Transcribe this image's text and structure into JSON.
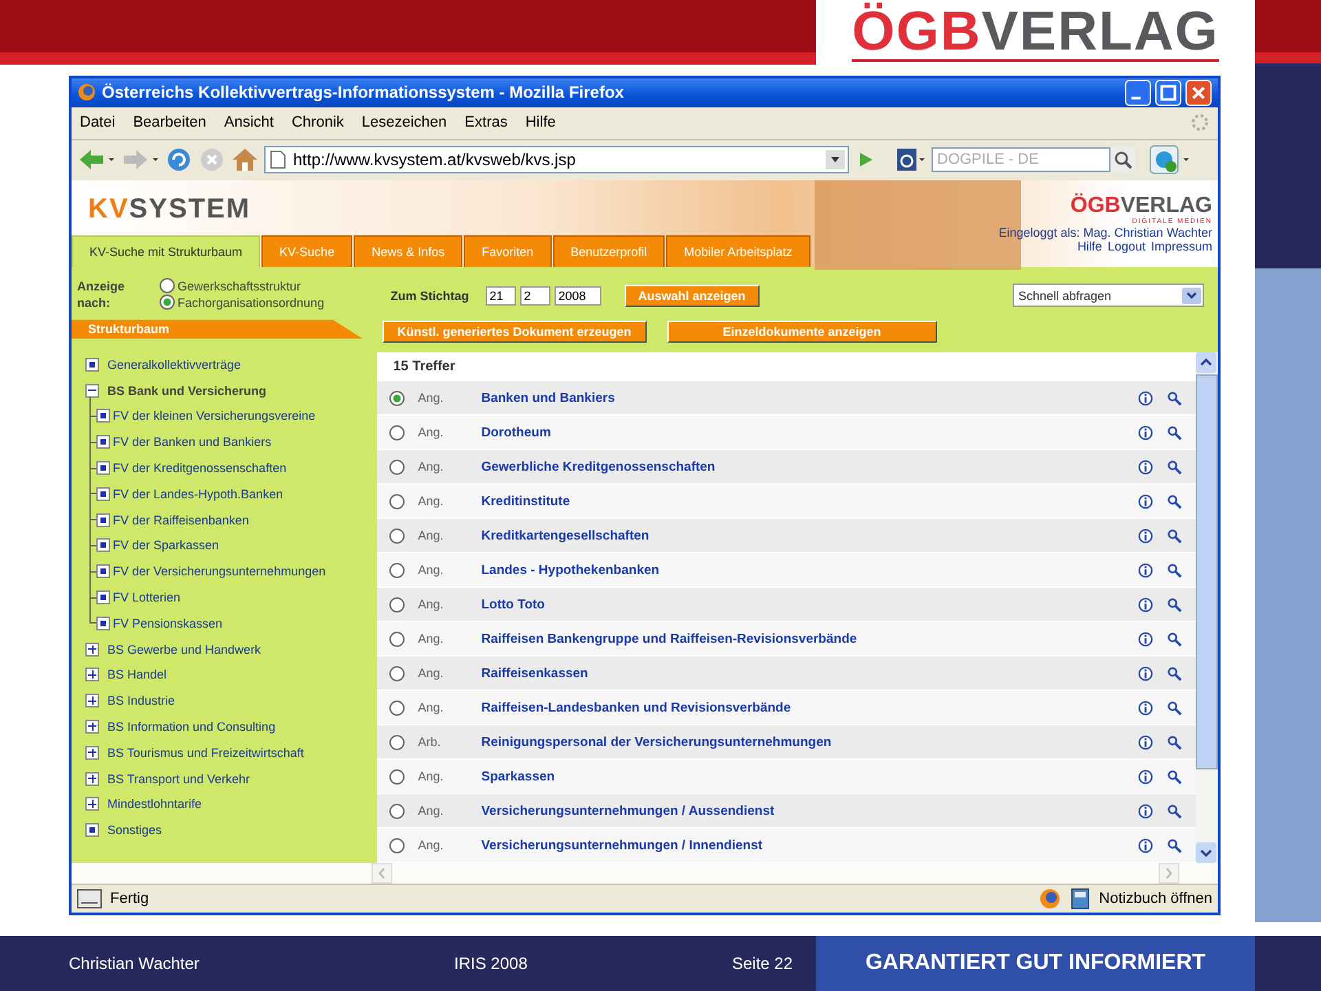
{
  "slide_header": {
    "logo": {
      "part_1": "ÖGB",
      "part_2": "VERLAG"
    }
  },
  "browser": {
    "title": "Österreichs Kollektivvertrags-Informationssystem - Mozilla Firefox",
    "menu": [
      "Datei",
      "Bearbeiten",
      "Ansicht",
      "Chronik",
      "Lesezeichen",
      "Extras",
      "Hilfe"
    ],
    "address": "http://www.kvsystem.at/kvsweb/kvs.jsp",
    "search": {
      "placeholder": "DOGPILE - DE"
    },
    "status": "Fertig",
    "status_right": "Notizbuch öffnen"
  },
  "site_header": {
    "logo": {
      "part_1": "KV",
      "part_2": "SYSTEM"
    },
    "publisher_logo": {
      "part_1": "ÖGB",
      "part_2": "VERLAG",
      "tagline": "DIGITALE MEDIEN"
    },
    "login": "Eingeloggt als: Mag. Christian Wachter",
    "links": [
      "Hilfe",
      "Logout",
      "Impressum"
    ],
    "tabs": [
      {
        "label": "KV-Suche mit Strukturbaum",
        "selected": true
      },
      {
        "label": "KV-Suche",
        "selected": false
      },
      {
        "label": "News & Infos",
        "selected": false
      },
      {
        "label": "Favoriten",
        "selected": false
      },
      {
        "label": "Benutzerprofil",
        "selected": false
      },
      {
        "label": "Mobiler Arbeitsplatz",
        "selected": false
      }
    ]
  },
  "sidebar": {
    "display_label": "Anzeige nach:",
    "display_options": [
      {
        "label": "Gewerkschaftsstruktur",
        "selected": false
      },
      {
        "label": "Fachorganisationsordnung",
        "selected": true
      }
    ],
    "tree_title": "Strukturbaum",
    "tree": [
      {
        "label": "Generalkollektivverträge",
        "kind": "leaf"
      },
      {
        "label": "BS Bank und Versicherung",
        "kind": "group",
        "expanded": true,
        "children": [
          {
            "label": "FV der kleinen Versicherungsvereine",
            "kind": "leaf"
          },
          {
            "label": "FV der Banken und Bankiers",
            "kind": "leaf"
          },
          {
            "label": "FV der Kreditgenossenschaften",
            "kind": "leaf"
          },
          {
            "label": "FV der Landes-Hypoth.Banken",
            "kind": "leaf"
          },
          {
            "label": "FV der Raiffeisenbanken",
            "kind": "leaf"
          },
          {
            "label": "FV der Sparkassen",
            "kind": "leaf"
          },
          {
            "label": "FV der Versicherungsunternehmungen",
            "kind": "leaf"
          },
          {
            "label": "FV Lotterien",
            "kind": "leaf"
          },
          {
            "label": "FV Pensionskassen",
            "kind": "leaf"
          }
        ]
      },
      {
        "label": "BS Gewerbe und Handwerk",
        "kind": "group",
        "expanded": false
      },
      {
        "label": "BS Handel",
        "kind": "group",
        "expanded": false
      },
      {
        "label": "BS Industrie",
        "kind": "group",
        "expanded": false
      },
      {
        "label": "BS Information und Consulting",
        "kind": "group",
        "expanded": false
      },
      {
        "label": "BS Tourismus und Freizeitwirtschaft",
        "kind": "group",
        "expanded": false
      },
      {
        "label": "BS Transport und Verkehr",
        "kind": "group",
        "expanded": false
      },
      {
        "label": "Mindestlohntarife",
        "kind": "group",
        "expanded": false
      },
      {
        "label": "Sonstiges",
        "kind": "leaf"
      }
    ]
  },
  "filter": {
    "date_label": "Zum Stichtag",
    "day": "21",
    "month": "2",
    "year": "2008",
    "show_button": "Auswahl anzeigen",
    "quick_select": "Schnell abfragen",
    "generate_button": "Künstl. generiertes Dokument erzeugen",
    "single_button": "Einzeldokumente anzeigen"
  },
  "results": {
    "count": "15 Treffer",
    "rows": [
      {
        "type": "Ang.",
        "title": "Banken und Bankiers",
        "selected": true
      },
      {
        "type": "Ang.",
        "title": "Dorotheum",
        "selected": false
      },
      {
        "type": "Ang.",
        "title": "Gewerbliche Kreditgenossenschaften",
        "selected": false
      },
      {
        "type": "Ang.",
        "title": "Kreditinstitute",
        "selected": false
      },
      {
        "type": "Ang.",
        "title": "Kreditkartengesellschaften",
        "selected": false
      },
      {
        "type": "Ang.",
        "title": "Landes - Hypothekenbanken",
        "selected": false
      },
      {
        "type": "Ang.",
        "title": "Lotto Toto",
        "selected": false
      },
      {
        "type": "Ang.",
        "title": "Raiffeisen Bankengruppe und Raiffeisen-Revisionsverbände",
        "selected": false
      },
      {
        "type": "Ang.",
        "title": "Raiffeisenkassen",
        "selected": false
      },
      {
        "type": "Ang.",
        "title": "Raiffeisen-Landesbanken und Revisionsverbände",
        "selected": false
      },
      {
        "type": "Arb.",
        "title": "Reinigungspersonal der Versicherungsunternehmungen",
        "selected": false
      },
      {
        "type": "Ang.",
        "title": "Sparkassen",
        "selected": false
      },
      {
        "type": "Ang.",
        "title": "Versicherungsunternehmungen / Aussendienst",
        "selected": false
      },
      {
        "type": "Ang.",
        "title": "Versicherungsunternehmungen / Innendienst",
        "selected": false
      }
    ]
  },
  "slide_footer": {
    "author": "Christian Wachter",
    "event": "IRIS 2008",
    "page": "Seite 22",
    "slogan": "GARANTIERT GUT INFORMIERT"
  }
}
